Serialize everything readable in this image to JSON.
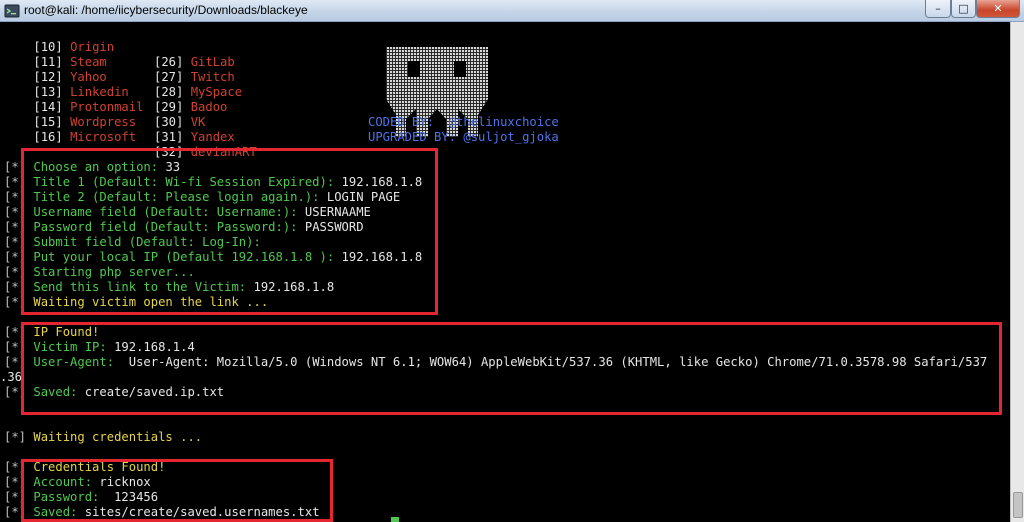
{
  "window": {
    "title": "root@kali: /home/iicybersecurity/Downloads/blackeye",
    "minimize_label": "–",
    "maximize_label": "□",
    "close_label": "✕"
  },
  "menu": {
    "left": [
      {
        "num": "[10]",
        "name": "Origin"
      },
      {
        "num": "[11]",
        "name": "Steam"
      },
      {
        "num": "[12]",
        "name": "Yahoo"
      },
      {
        "num": "[13]",
        "name": "Linkedin"
      },
      {
        "num": "[14]",
        "name": "Protonmail"
      },
      {
        "num": "[15]",
        "name": "Wordpress"
      },
      {
        "num": "[16]",
        "name": "Microsoft"
      }
    ],
    "right": [
      {
        "num": "[26]",
        "name": "GitLab"
      },
      {
        "num": "[27]",
        "name": "Twitch"
      },
      {
        "num": "[28]",
        "name": "MySpace"
      },
      {
        "num": "[29]",
        "name": "Badoo"
      },
      {
        "num": "[30]",
        "name": "VK"
      },
      {
        "num": "[31]",
        "name": "Yandex"
      },
      {
        "num": "[32]",
        "name": "devianART"
      }
    ]
  },
  "credits": {
    "coded_by": "CODED BY:  @thelinuxchoice",
    "upgraded_by": "UPGRADED BY: @suljot_gjoka"
  },
  "prefix": "[*]",
  "section1": [
    {
      "label": "Choose an option: ",
      "value": "33"
    },
    {
      "label": "Title 1 (Default: Wi-fi Session Expired): ",
      "value": "192.168.1.8"
    },
    {
      "label": "Title 2 (Default: Please login again.): ",
      "value": "LOGIN PAGE"
    },
    {
      "label": "Username field (Default: Username:): ",
      "value": "USERNAAME"
    },
    {
      "label": "Password field (Default: Password:): ",
      "value": "PASSWORD"
    },
    {
      "label": "Submit field (Default: Log-In): ",
      "value": ""
    },
    {
      "label": "Put your local IP (Default 192.168.1.8 ): ",
      "value": "192.168.1.8"
    },
    {
      "label": "Starting php server...",
      "value": ""
    },
    {
      "label": "Send this link to the Victim: ",
      "value": "192.168.1.8"
    },
    {
      "label": "Waiting victim open the link ...",
      "value": ""
    }
  ],
  "section2": {
    "ip_found": "IP Found!",
    "victim_ip_label": "Victim IP: ",
    "victim_ip": "192.168.1.4",
    "ua_label": "User-Agent: ",
    "ua_value": " User-Agent: Mozilla/5.0 (Windows NT 6.1; WOW64) AppleWebKit/537.36 (KHTML, like Gecko) Chrome/71.0.3578.98 Safari/537",
    "ua_wrap": ".36",
    "saved_label": "Saved: ",
    "saved_value": "create/saved.ip.txt"
  },
  "waiting_credentials": "Waiting credentials ...",
  "section3": {
    "found": "Credentials Found!",
    "account_label": "Account: ",
    "account_value": "ricknox",
    "password_label": "Password: ",
    "password_value": " 123456",
    "saved_label": "Saved: ",
    "saved_value": "sites/create/saved.usernames.txt"
  }
}
